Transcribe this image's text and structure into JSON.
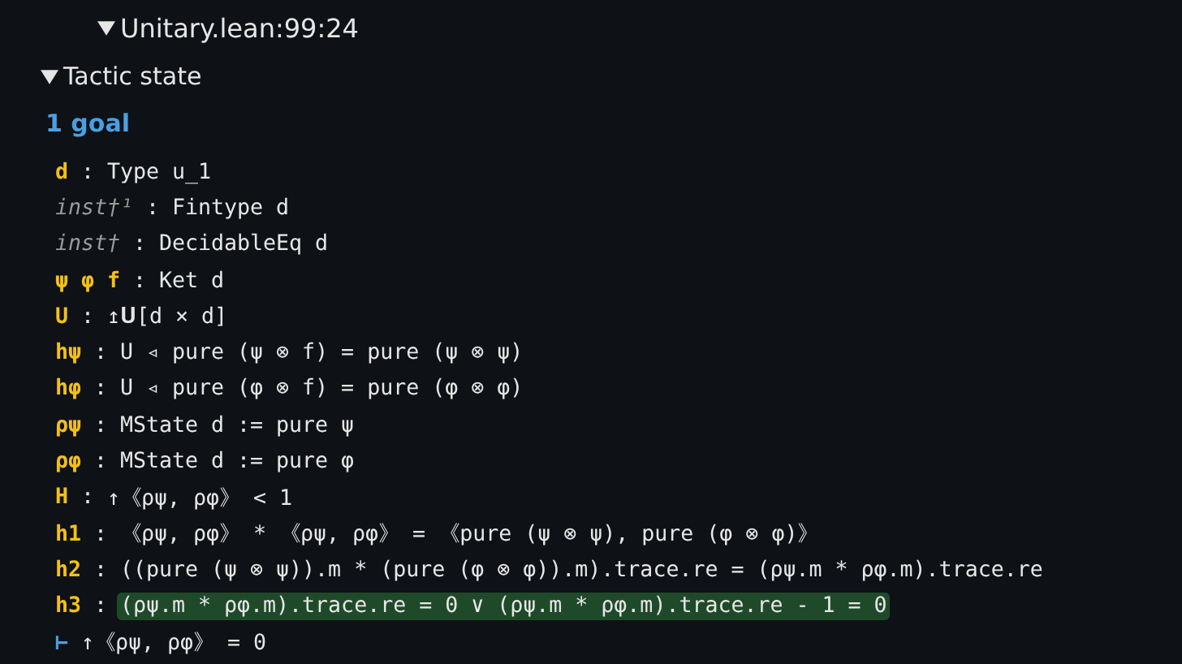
{
  "header": {
    "title": "Unitary.lean:99:24",
    "expanded": true
  },
  "section": {
    "title": "Tactic state",
    "expanded": true
  },
  "goal_count": "1 goal",
  "hypotheses": [
    {
      "names": "d",
      "separator": ":",
      "type": "Type u_1",
      "inaccessible": false,
      "highlighted": false
    },
    {
      "names": "inst†¹",
      "separator": ":",
      "type": "Fintype d",
      "inaccessible": true,
      "highlighted": false
    },
    {
      "names": "inst†",
      "separator": ":",
      "type": "DecidableEq d",
      "inaccessible": true,
      "highlighted": false
    },
    {
      "names": "ψ φ f",
      "separator": ":",
      "type": "Ket d",
      "inaccessible": false,
      "highlighted": false
    },
    {
      "names": "U",
      "separator": ":",
      "type": "↥𝐔[d × d]",
      "inaccessible": false,
      "highlighted": false
    },
    {
      "names": "hψ",
      "separator": ":",
      "type": "U ◃ pure (ψ ⊗ f) = pure (ψ ⊗ ψ)",
      "inaccessible": false,
      "highlighted": false
    },
    {
      "names": "hφ",
      "separator": ":",
      "type": "U ◃ pure (φ ⊗ f) = pure (φ ⊗ φ)",
      "inaccessible": false,
      "highlighted": false
    },
    {
      "names": "ρψ",
      "separator": ":",
      "type": "MState d := pure ψ",
      "inaccessible": false,
      "highlighted": false
    },
    {
      "names": "ρφ",
      "separator": ":",
      "type": "MState d := pure φ",
      "inaccessible": false,
      "highlighted": false
    },
    {
      "names": "H",
      "separator": ":",
      "type": "↑《ρψ, ρφ》 < 1",
      "inaccessible": false,
      "highlighted": false
    },
    {
      "names": "h1",
      "separator": ":",
      "type": "《ρψ, ρφ》 * 《ρψ, ρφ》 = 《pure (ψ ⊗ ψ), pure (φ ⊗ φ)》",
      "inaccessible": false,
      "highlighted": false
    },
    {
      "names": "h2",
      "separator": ":",
      "type": "((pure (ψ ⊗ ψ)).m * (pure (φ ⊗ φ)).m).trace.re = (ρψ.m * ρφ.m).trace.re",
      "inaccessible": false,
      "highlighted": false
    },
    {
      "names": "h3",
      "separator": ":",
      "type": "(ρψ.m * ρφ.m).trace.re = 0 ∨ (ρψ.m * ρφ.m).trace.re - 1 = 0",
      "inaccessible": false,
      "highlighted": true
    }
  ],
  "goal": {
    "turnstile": "⊢",
    "type": "↑《ρψ, ρφ》 = 0"
  }
}
